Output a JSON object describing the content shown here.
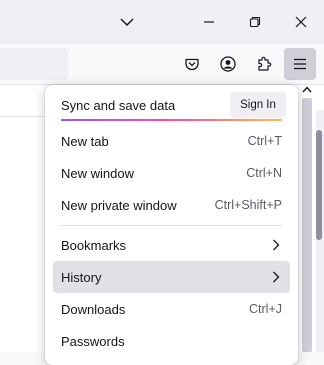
{
  "titlebar": {
    "list_all_tabs_icon": "chevron-down-icon",
    "minimize_icon": "minimize-icon",
    "maximize_icon": "restore-icon",
    "close_icon": "close-icon"
  },
  "toolbar": {
    "buttons": [
      "pocket-icon",
      "account-icon",
      "extensions-icon",
      "menu-icon"
    ]
  },
  "menu": {
    "sync": {
      "label": "Sync and save data",
      "signin_label": "Sign In"
    },
    "items": [
      {
        "label": "New tab",
        "shortcut": "Ctrl+T"
      },
      {
        "label": "New window",
        "shortcut": "Ctrl+N"
      },
      {
        "label": "New private window",
        "shortcut": "Ctrl+Shift+P"
      },
      {
        "label": "Bookmarks",
        "submenu": true
      },
      {
        "label": "History",
        "submenu": true,
        "highlighted": true
      },
      {
        "label": "Downloads",
        "shortcut": "Ctrl+J"
      },
      {
        "label": "Passwords",
        "shortcut": ""
      }
    ]
  },
  "colors": {
    "accent_gradient": [
      "#9059ff",
      "#ff4aa2",
      "#ffbd4f"
    ],
    "hover": "#e0e0e6"
  }
}
